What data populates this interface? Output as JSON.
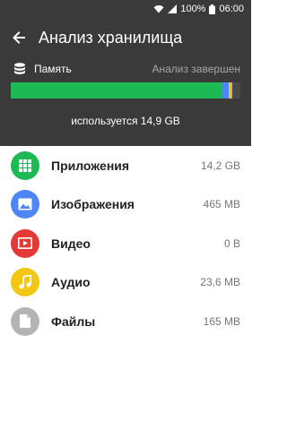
{
  "status_bar": {
    "battery": "100%",
    "time": "06:00",
    "icons": [
      "wifi-icon",
      "signal-icon",
      "battery-icon"
    ]
  },
  "app_bar": {
    "title": "Анализ хранилища",
    "back_icon": "arrow-left-icon"
  },
  "storage": {
    "label": "Память",
    "status": "Анализ завершен",
    "used_text": "используется 14,9 GB",
    "usage_bar": [
      {
        "category": "apps",
        "color": "#1db954",
        "fraction": 0.92
      },
      {
        "category": "images",
        "color": "#4f86f7",
        "fraction": 0.03
      },
      {
        "category": "audio",
        "color": "#f3c613",
        "fraction": 0.006
      },
      {
        "category": "files",
        "color": "#b4b4b4",
        "fraction": 0.01
      }
    ]
  },
  "categories": [
    {
      "name": "Приложения",
      "size": "14,2 GB",
      "icon": "apps-grid-icon",
      "color": "#1db954"
    },
    {
      "name": "Изображения",
      "size": "465 MB",
      "icon": "image-icon",
      "color": "#4f86f7"
    },
    {
      "name": "Видео",
      "size": "0 B",
      "icon": "video-play-icon",
      "color": "#e53935"
    },
    {
      "name": "Аудио",
      "size": "23,6 MB",
      "icon": "music-note-icon",
      "color": "#f3c613"
    },
    {
      "name": "Файлы",
      "size": "165 MB",
      "icon": "file-icon",
      "color": "#b4b4b4"
    }
  ],
  "colors": {
    "header_bg": "#3a3a3a",
    "list_bg": "#ffffff"
  }
}
